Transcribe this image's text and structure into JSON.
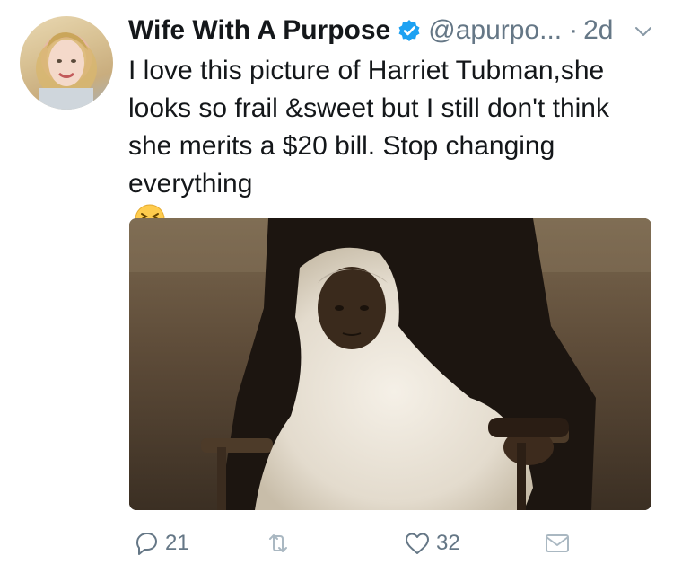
{
  "tweet": {
    "name": "Wife With A Purpose",
    "handle": "@apurpo...",
    "separator": "·",
    "time": "2d",
    "text_lines": [
      "I love this picture of Harriet Tubman,she",
      "looks so frail &sweet but I still don't think",
      "she merits a $20 bill.  Stop changing",
      "everything"
    ],
    "emoji": "tired-face-emoji",
    "verified": true
  },
  "actions": {
    "reply_count": "21",
    "retweet_count": "",
    "like_count": "32"
  },
  "colors": {
    "text": "#14171a",
    "secondary": "#657786",
    "verified": "#1da1f2"
  }
}
